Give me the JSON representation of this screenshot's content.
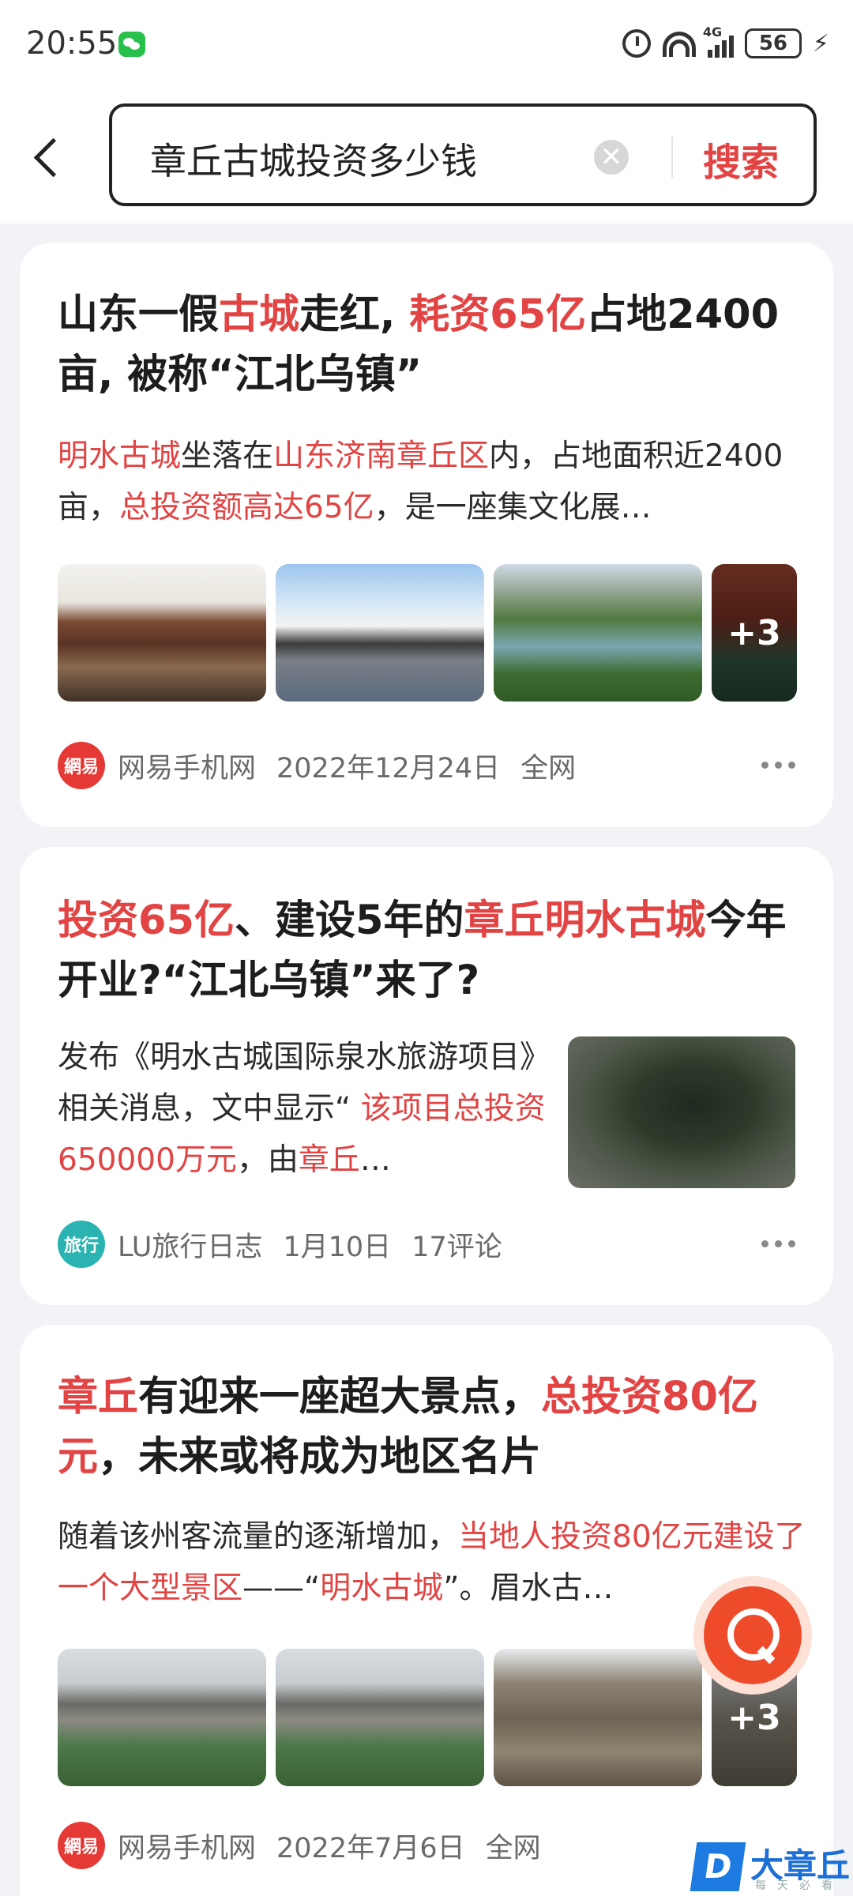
{
  "status": {
    "time": "20:55",
    "network": "4G",
    "battery": "56"
  },
  "search": {
    "query": "章丘古城投资多少钱",
    "clear_symbol": "✕",
    "button_label": "搜索"
  },
  "results": [
    {
      "title": [
        {
          "t": "山东一假",
          "hl": false
        },
        {
          "t": "古城",
          "hl": true
        },
        {
          "t": "走红, ",
          "hl": false
        },
        {
          "t": "耗资65亿",
          "hl": true
        },
        {
          "t": "占地2400亩, 被称“江北乌镇”",
          "hl": false
        }
      ],
      "snippet": [
        {
          "t": "明水古城",
          "hl": true
        },
        {
          "t": "坐落在",
          "hl": false
        },
        {
          "t": "山东济南章丘区",
          "hl": true
        },
        {
          "t": "内，占地面积近2400亩，",
          "hl": false
        },
        {
          "t": "总投资额高达65亿",
          "hl": true
        },
        {
          "t": "，是一座集文化展…",
          "hl": false
        }
      ],
      "more_images": "+3",
      "source": "网易手机网",
      "source_logo": "網易",
      "date": "2022年12月24日",
      "extra": "全网"
    },
    {
      "title": [
        {
          "t": "投资65亿",
          "hl": true
        },
        {
          "t": "、建设5年的",
          "hl": false
        },
        {
          "t": "章丘明水古城",
          "hl": true
        },
        {
          "t": "今年开业?“江北乌镇”来了?",
          "hl": false
        }
      ],
      "snippet": [
        {
          "t": "发布《明水古城国际泉水旅游项目》相关消息，文中显示“ ",
          "hl": false
        },
        {
          "t": "该项目总投资650000万元",
          "hl": true
        },
        {
          "t": "，由",
          "hl": false
        },
        {
          "t": "章丘",
          "hl": true
        },
        {
          "t": "…",
          "hl": false
        }
      ],
      "source": "LU旅行日志",
      "source_logo": "旅行",
      "date": "1月10日",
      "extra": "17评论"
    },
    {
      "title": [
        {
          "t": "章丘",
          "hl": true
        },
        {
          "t": "有迎来一座超大景点，",
          "hl": false
        },
        {
          "t": "总投资80亿元",
          "hl": true
        },
        {
          "t": "，未来或将成为地区名片",
          "hl": false
        }
      ],
      "snippet": [
        {
          "t": "随着该州客流量的逐渐增加，",
          "hl": false
        },
        {
          "t": "当地人投资80亿元建设了一个大型景区",
          "hl": true
        },
        {
          "t": "——“",
          "hl": false
        },
        {
          "t": "明水古城",
          "hl": true
        },
        {
          "t": "”。眉水古…",
          "hl": false
        }
      ],
      "more_images": "+3",
      "source": "网易手机网",
      "source_logo": "網易",
      "date": "2022年7月6日",
      "extra": "全网"
    }
  ],
  "watermark": {
    "box": "D",
    "name": "大章丘",
    "sub": "每天必看"
  }
}
